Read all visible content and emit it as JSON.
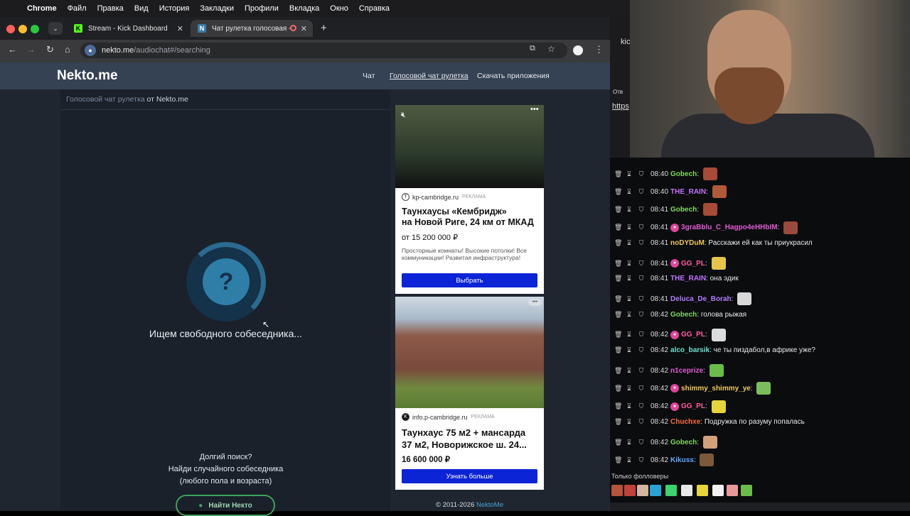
{
  "menubar": {
    "app": "Chrome",
    "items": [
      "Файл",
      "Правка",
      "Вид",
      "История",
      "Закладки",
      "Профили",
      "Вкладка",
      "Окно",
      "Справка"
    ]
  },
  "tabs": [
    {
      "title": "Stream - Kick Dashboard",
      "favicon": "K"
    },
    {
      "title": "Чат рулетка голосовая - ",
      "favicon": "N"
    }
  ],
  "address": {
    "host": "nekto.me",
    "path": "/audiochat#/searching"
  },
  "site": {
    "logo": "Nekto.me",
    "nav": [
      "Чат",
      "Голосовой чат рулетка",
      "Скачать приложения"
    ],
    "breadcrumb_muted": "Голосовой чат рулетка",
    "breadcrumb_rest": " от Nekto.me",
    "question_mark": "?",
    "searching_text": "Ищем свободного собеседника...",
    "long_search": [
      "Долгий поиск?",
      "Найди случайного собеседника",
      "(любого пола и возраста)"
    ],
    "find_button": "Найти Некто",
    "copyright": "© 2011-2026 ",
    "copyright_link": "NektoMe"
  },
  "ads": [
    {
      "source": "kp-cambridge.ru",
      "tag": "РЕКЛАМА",
      "title_line1": "Таунхаусы «Кембридж»",
      "title_line2": "на Новой Риге, 24 км от МКАД",
      "price": "от 15 200 000 ₽",
      "desc": "Просторные комнаты! Высокие потолки! Все коммуникации! Развитая инфраструктура!",
      "button": "Выбрать"
    },
    {
      "source": "info.p-cambridge.ru",
      "tag": "РЕКЛАМА",
      "title_line1": "Таунхаус 75 м2 + мансарда",
      "title_line2": "37 м2, Новорижское ш. 24...",
      "price": "16 600 000 ₽",
      "button": "Узнать больше"
    }
  ],
  "overlay": {
    "kick_fragment": "kic",
    "link_fragment": "https",
    "reply_fragment": "Отв"
  },
  "chat": [
    {
      "time": "08:40",
      "user": "Gobech",
      "color": "#7ed957",
      "text": ""
    },
    {
      "time": "08:40",
      "user": "THE_RAIN",
      "color": "#c473ff",
      "text": ""
    },
    {
      "time": "08:41",
      "user": "Gobech",
      "color": "#7ed957",
      "text": ""
    },
    {
      "time": "08:41",
      "user": "3graBblu_C_Hagpo4eHHbIM",
      "color": "#e15bd6",
      "text": ""
    },
    {
      "time": "08:41",
      "user": "noDYDuM",
      "color": "#f0c75a",
      "text": "Расскажи ей как ты приукрасил"
    },
    {
      "time": "08:41",
      "user": "GG_PL",
      "color": "#ff5f9e",
      "text": ""
    },
    {
      "time": "08:41",
      "user": "THE_RAIN",
      "color": "#c473ff",
      "text": "она эдик"
    },
    {
      "time": "08:41",
      "user": "Deluca_De_Borah",
      "color": "#b07dff",
      "text": ""
    },
    {
      "time": "08:42",
      "user": "Gobech",
      "color": "#7ed957",
      "text": "голова рыжая"
    },
    {
      "time": "08:42",
      "user": "GG_PL",
      "color": "#ff5f9e",
      "text": ""
    },
    {
      "time": "08:42",
      "user": "alco_barsik",
      "color": "#6fe0d0",
      "text": "че ты пиздабол,в африке уже?"
    },
    {
      "time": "08:42",
      "user": "n1ceprize",
      "color": "#e15bd6",
      "text": ""
    },
    {
      "time": "08:42",
      "user": "shimmy_shimmy_ye",
      "color": "#f0c75a",
      "text": ""
    },
    {
      "time": "08:42",
      "user": "GG_PL",
      "color": "#ff5f9e",
      "text": ""
    },
    {
      "time": "08:42",
      "user": "Chuchxe",
      "color": "#ff6a3d",
      "text": "Подружка по разуму попалась"
    },
    {
      "time": "08:42",
      "user": "Gobech",
      "color": "#7ed957",
      "text": ""
    },
    {
      "time": "08:42",
      "user": "Kikuss",
      "color": "#5aa7ff",
      "text": ""
    }
  ],
  "followers_only": "Только фолловеры"
}
